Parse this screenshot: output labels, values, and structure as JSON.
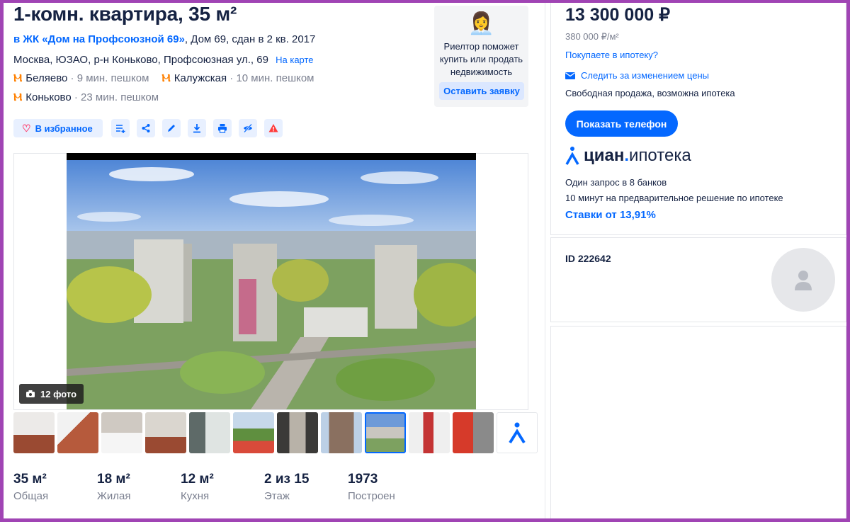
{
  "listing": {
    "title": "1-комн. квартира, 35 м²",
    "complex_link": "в ЖК «Дом на Профсоюзной 69»",
    "complex_rest": ", Дом 69, сдан в 2 кв. 2017",
    "address": "Москва, ЮЗАО, р-н Коньково, Профсоюзная ул., 69",
    "map_link": "На карте",
    "metro": [
      {
        "name": "Беляево",
        "time": "· 9 мин. пешком"
      },
      {
        "name": "Калужская",
        "time": "· 10 мин. пешком"
      },
      {
        "name": "Коньково",
        "time": "· 23 мин. пешком"
      }
    ],
    "colors": {
      "accent": "#0468ff",
      "metro": "#ff8000",
      "frame": "#a044b4"
    }
  },
  "realtor_promo": {
    "text": "Риелтор поможет купить или продать недвижимость",
    "button": "Оставить заявку",
    "icon": "realtor-woman-emoji"
  },
  "actions": {
    "favorite": "В избранное",
    "icons": [
      "compare-icon",
      "share-icon",
      "edit-icon",
      "download-icon",
      "print-icon",
      "hide-icon",
      "report-icon"
    ]
  },
  "gallery": {
    "photo_count": "12 фото",
    "thumb_count": 11,
    "active_thumb": 8
  },
  "facts": [
    {
      "value": "35 м²",
      "label": "Общая"
    },
    {
      "value": "18 м²",
      "label": "Жилая"
    },
    {
      "value": "12 м²",
      "label": "Кухня"
    },
    {
      "value": "2 из 15",
      "label": "Этаж"
    },
    {
      "value": "1973",
      "label": "Построен"
    }
  ],
  "sidebar": {
    "price": "13 300 000 ₽",
    "price_per_m2": "380 000 ₽/м²",
    "mortgage_link": "Покупаете в ипотеку?",
    "watch_price": "Следить за изменением цены",
    "sale_type": "Свободная продажа, возможна ипотека",
    "phone_button": "Показать телефон",
    "ipoteka": {
      "brand": "циан",
      "product": "ипотека",
      "line1": "Один запрос в 8 банков",
      "line2": "10 минут на предварительное решение по ипотеке",
      "rates": "Ставки от 13,91%"
    },
    "id_text": "ID 222642"
  }
}
